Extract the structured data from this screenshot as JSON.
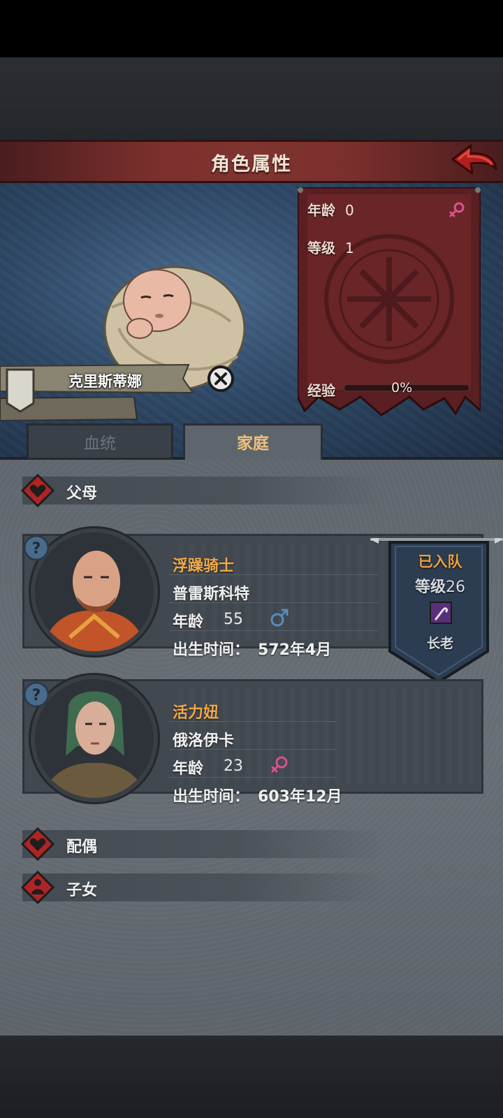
{
  "header": {
    "title": "角色属性"
  },
  "character": {
    "name": "克里斯蒂娜",
    "age_label": "年龄",
    "age": "0",
    "level_label": "等级",
    "level": "1",
    "exp_label": "经验",
    "exp_text": "0%",
    "exp_progress": 0,
    "gender_icon": "female-icon"
  },
  "tabs": [
    {
      "label": "血统",
      "active": false
    },
    {
      "label": "家庭",
      "active": true
    }
  ],
  "sections": {
    "parents": "父母",
    "spouse": "配偶",
    "children": "子女"
  },
  "parents": [
    {
      "title": "浮躁骑士",
      "name": "普雷斯科特",
      "age_label": "年龄",
      "age": "55",
      "gender_icon": "male-icon",
      "birth_label": "出生时间：",
      "birth": "572年4月",
      "party": {
        "status": "已入队",
        "level_label": "等级",
        "level": "26",
        "role": "长老",
        "icon": "staff-icon"
      }
    },
    {
      "title": "活力妞",
      "name": "俄洛伊卡",
      "age_label": "年龄",
      "age": "23",
      "gender_icon": "female-icon",
      "birth_label": "出生时间：",
      "birth": "603年12月"
    }
  ],
  "colors": {
    "title_bar": "#7a2f2c",
    "accent_orange": "#f0a84a",
    "female_pink": "#d9548a",
    "male_blue": "#5b8bbd",
    "tab_active_text": "#f0c27a"
  }
}
